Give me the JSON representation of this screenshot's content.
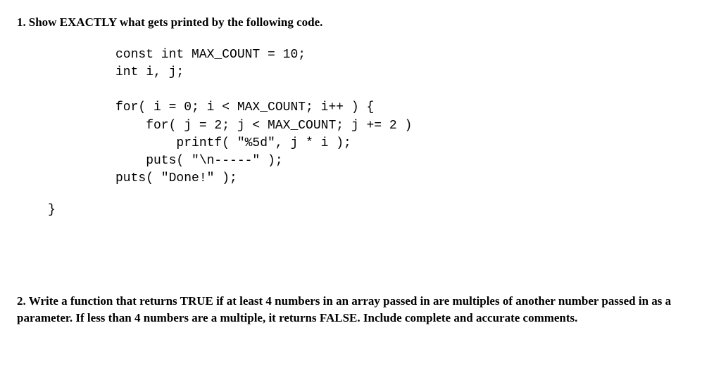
{
  "q1": {
    "number": "1.",
    "prompt": "Show EXACTLY what gets printed by the following code.",
    "code": "const int MAX_COUNT = 10;\nint i, j;\n\nfor( i = 0; i < MAX_COUNT; i++ ) {\n    for( j = 2; j < MAX_COUNT; j += 2 )\n        printf( \"%5d\", j * i );\n    puts( \"\\n-----\" );\nputs( \"Done!\" );",
    "closing_brace": "}"
  },
  "q2": {
    "number": "2.",
    "prompt": "Write a function that returns TRUE if at least 4 numbers in an array passed in are multiples of another number passed in as a parameter.  If less than 4 numbers are a multiple, it returns FALSE.  Include complete and accurate comments."
  }
}
